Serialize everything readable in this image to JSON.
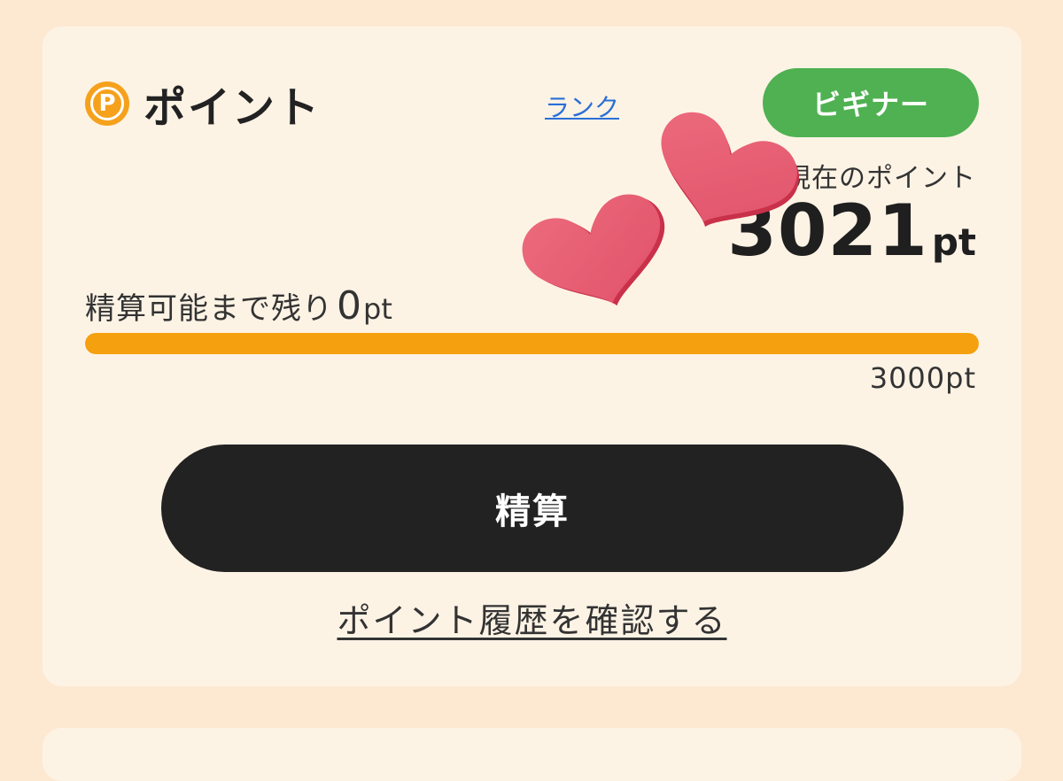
{
  "points_card": {
    "title": "ポイント",
    "icon": "p-coin-icon",
    "icon_letter": "P",
    "rank_link": "ランク",
    "rank_badge": "ビギナー",
    "current_label": "現在のポイント",
    "current_points": "3021",
    "current_unit": "pt",
    "remaining_label": "精算可能まで残り",
    "remaining_value": "0",
    "remaining_unit": "pt",
    "progress_fraction": 1.0,
    "target_label": "3000pt",
    "settle_button": "精算",
    "history_link": "ポイント履歴を確認する"
  },
  "colors": {
    "background": "#fde9d2",
    "card": "#fdf3e5",
    "accent_orange": "#f5a00f",
    "badge_green": "#4fb152",
    "button_dark": "#222222",
    "link_blue": "#2a6fd6",
    "heart": "#e85d72"
  },
  "overlay": {
    "sticker": "hearts-sticker-icon"
  }
}
